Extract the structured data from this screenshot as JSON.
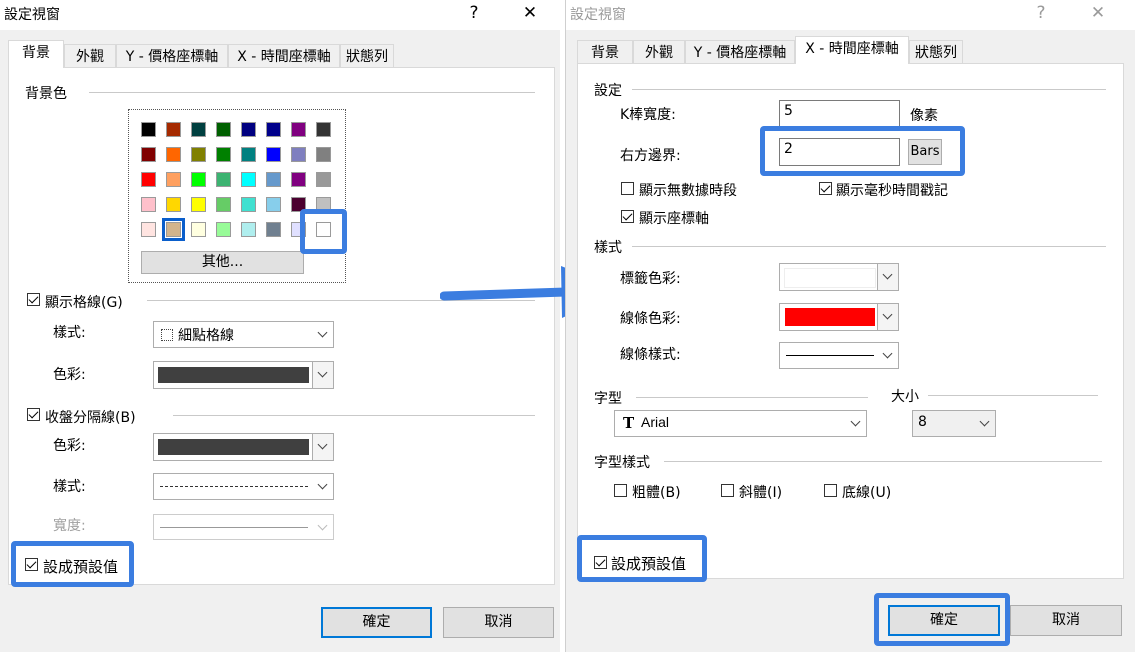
{
  "left_dialog": {
    "title": "設定視窗",
    "help_glyph": "?",
    "close_glyph": "✕",
    "tabs": [
      "背景",
      "外觀",
      "Y - 價格座標軸",
      "X - 時間座標軸",
      "狀態列"
    ],
    "background_section": "背景色",
    "palette": [
      [
        "#000000",
        "#a52a00",
        "#004040",
        "#006000",
        "#000080",
        "#00008b",
        "#800080",
        "#333333"
      ],
      [
        "#800000",
        "#ff6600",
        "#808000",
        "#008000",
        "#008080",
        "#0000ff",
        "#7f7fbf",
        "#808080"
      ],
      [
        "#ff0000",
        "#ffa060",
        "#00ff00",
        "#3cb371",
        "#00ffff",
        "#6699cc",
        "#800080",
        "#999999"
      ],
      [
        "#ffc0cb",
        "#ffd700",
        "#ffff00",
        "#66cc66",
        "#40e0d0",
        "#87ceeb",
        "#4b0030",
        "#c0c0c0"
      ],
      [
        "#ffe4e1",
        "#d2b48c",
        "#ffffe0",
        "#98fb98",
        "#afeeee",
        "#708090",
        "#e0e0ff",
        "#ffffff"
      ]
    ],
    "palette_more": "其他...",
    "gridlines": {
      "label": "顯示格線(G)",
      "checked": true,
      "style_label": "樣式:",
      "style_value": "細點格線",
      "color_label": "色彩:",
      "color_value": "#404040"
    },
    "separator": {
      "label": "收盤分隔線(B)",
      "checked": true,
      "color_label": "色彩:",
      "color_value": "#404040",
      "style_label": "樣式:",
      "width_label": "寬度:"
    },
    "set_default": {
      "label": "設成預設值",
      "checked": true
    },
    "ok": "確定",
    "cancel": "取消"
  },
  "right_dialog": {
    "title": "設定視窗",
    "help_glyph": "?",
    "close_glyph": "✕",
    "tabs": [
      "背景",
      "外觀",
      "Y - 價格座標軸",
      "X - 時間座標軸",
      "狀態列"
    ],
    "settings_section": "設定",
    "bar_width_label": "K棒寬度:",
    "bar_width_value": "5",
    "bar_width_unit": "像素",
    "right_margin_label": "右方邊界:",
    "right_margin_value": "2",
    "right_margin_unit": "Bars",
    "show_no_data": {
      "label": "顯示無數據時段",
      "checked": false
    },
    "show_ms": {
      "label": "顯示毫秒時間戳記",
      "checked": true
    },
    "show_axis": {
      "label": "顯示座標軸",
      "checked": true
    },
    "style_section": "樣式",
    "tag_color_label": "標籤色彩:",
    "tag_color_value": "#ffffff",
    "line_color_label": "線條色彩:",
    "line_color_value": "#ff0000",
    "line_style_label": "線條樣式:",
    "font_section": "字型",
    "size_label": "大小",
    "font_value": "Arial",
    "size_value": "8",
    "font_style_section": "字型樣式",
    "bold": {
      "label": "粗體(B)",
      "checked": false
    },
    "italic": {
      "label": "斜體(I)",
      "checked": false
    },
    "underline": {
      "label": "底線(U)",
      "checked": false
    },
    "set_default": {
      "label": "設成預設值",
      "checked": true
    },
    "ok": "確定",
    "cancel": "取消"
  },
  "colors": {
    "highlight": "#3b7de0",
    "arrow": "#3b7de0",
    "accent": "#0078d7"
  }
}
